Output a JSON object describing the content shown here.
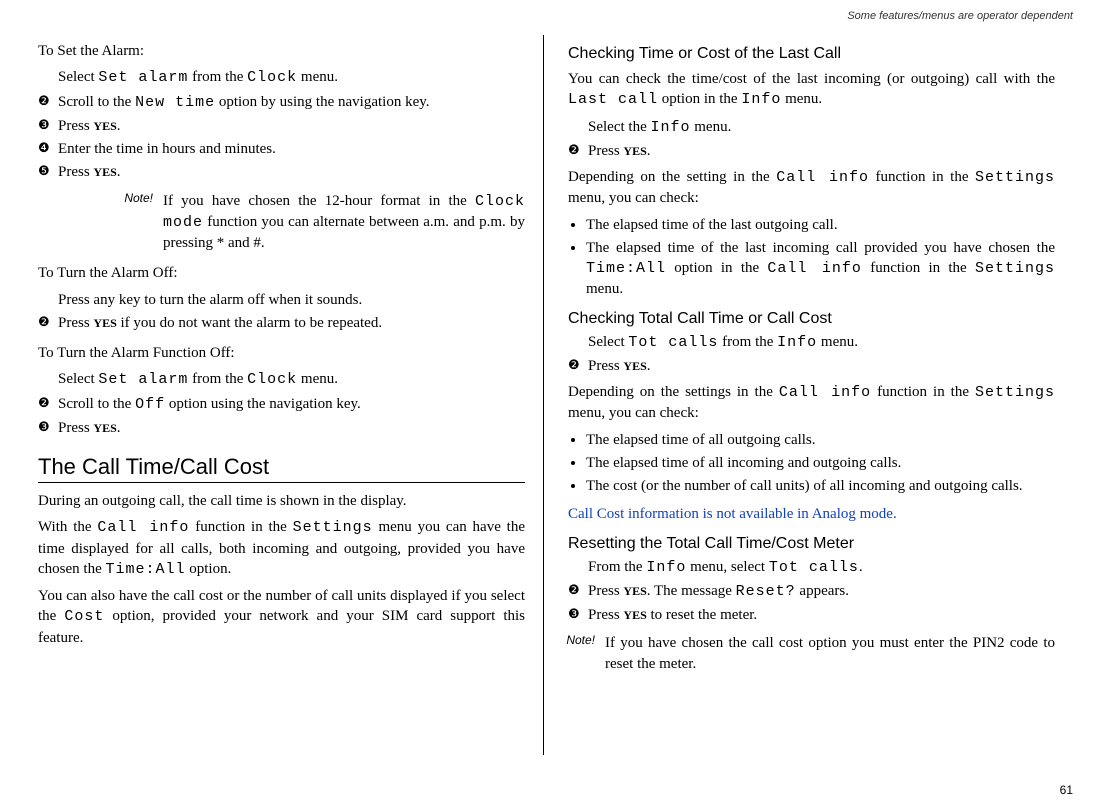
{
  "header": "Some features/menus are operator dependent",
  "page_number": "61",
  "left": {
    "toSetAlarm": "To Set the Alarm:",
    "step1a": "Select ",
    "step1b": "Set alarm",
    "step1c": " from the ",
    "step1d": "Clock",
    "step1e": " menu.",
    "step2a": "Scroll to the ",
    "step2b": "New time",
    "step2c": " option by using the navigation key.",
    "step3a": "Press ",
    "step3b": "YES",
    "step3c": ".",
    "step4": "Enter the time in hours and minutes.",
    "step5a": "Press ",
    "step5b": "YES",
    "step5c": ".",
    "noteLabel": "Note!",
    "note1a": "If you have chosen the 12-hour format in the ",
    "note1b": "Clock mode",
    "note1c": " function you can alternate between a.m. and p.m. by pressing * and #.",
    "turnOffHead": "To Turn the Alarm Off:",
    "turnOff1": "Press any key to turn the alarm off when it sounds.",
    "turnOff2a": "Press ",
    "turnOff2b": "YES",
    "turnOff2c": " if you do not want the alarm to be repeated.",
    "funcOffHead": "To Turn the Alarm Function Off:",
    "funcOff1a": "Select ",
    "funcOff1b": "Set alarm",
    "funcOff1c": " from the ",
    "funcOff1d": "Clock",
    "funcOff1e": " menu.",
    "funcOff2a": "Scroll to the ",
    "funcOff2b": "Off",
    "funcOff2c": " option using the navigation key.",
    "funcOff3a": "Press ",
    "funcOff3b": "YES",
    "funcOff3c": ".",
    "h1": "The Call Time/Call Cost",
    "p1": "During an outgoing call, the call time is shown in the display.",
    "p2a": "With the ",
    "p2b": "Call info",
    "p2c": " function in the ",
    "p2d": "Settings",
    "p2e": " menu you can have the time displayed for all calls, both incoming and outgoing, provided you have chosen the ",
    "p2f": "Time:All",
    "p2g": " option.",
    "p3a": "You can also have the call cost or the number of call units displayed if you select the ",
    "p3b": "Cost",
    "p3c": " option, provided your network and your SIM card support this feature."
  },
  "right": {
    "h2a": "Checking Time or Cost of the Last Call",
    "p1a": "You can check the time/cost of the last incoming (or outgoing) call with the ",
    "p1b": "Last call",
    "p1c": " option in the ",
    "p1d": "Info",
    "p1e": " menu.",
    "s1a": "Select the ",
    "s1b": "Info",
    "s1c": " menu.",
    "s2a": "Press ",
    "s2b": "YES",
    "s2c": ".",
    "p2a": "Depending on the setting in the ",
    "p2b": "Call info",
    "p2c": " function in the ",
    "p2d": "Settings",
    "p2e": " menu, you can check:",
    "b1": "The elapsed time of the last outgoing call.",
    "b2a": "The elapsed time of the last incoming call provided you have chosen the ",
    "b2b": "Time:All",
    "b2c": " option in the ",
    "b2d": "Call info",
    "b2e": " function in the ",
    "b2f": "Settings",
    "b2g": " menu.",
    "h2b": "Checking Total Call Time or Call Cost",
    "s3a": "Select ",
    "s3b": "Tot calls",
    "s3c": " from the ",
    "s3d": "Info",
    "s3e": " menu.",
    "s4a": "Press ",
    "s4b": "YES",
    "s4c": ".",
    "p3a": "Depending on the settings in the ",
    "p3b": "Call info",
    "p3c": " function in the ",
    "p3d": "Settings",
    "p3e": " menu, you can check:",
    "b3": "The elapsed time of all outgoing calls.",
    "b4": "The elapsed time of all incoming and outgoing calls.",
    "b5": "The cost (or the number of call units) of all incoming and outgoing calls.",
    "blue": "Call Cost information is not available in Analog mode.",
    "h2c": "Resetting the Total Call Time/Cost Meter",
    "r1a": "From the ",
    "r1b": "Info",
    "r1c": " menu, select ",
    "r1d": "Tot calls",
    "r1e": ".",
    "r2a": "Press ",
    "r2b": "YES",
    "r2c": ". The message ",
    "r2d": "Reset?",
    "r2e": " appears.",
    "r3a": "Press ",
    "r3b": "YES",
    "r3c": " to reset the meter.",
    "noteLabel": "Note!",
    "note2": "If you have chosen the call cost option you must enter the PIN2 code to reset the meter."
  }
}
